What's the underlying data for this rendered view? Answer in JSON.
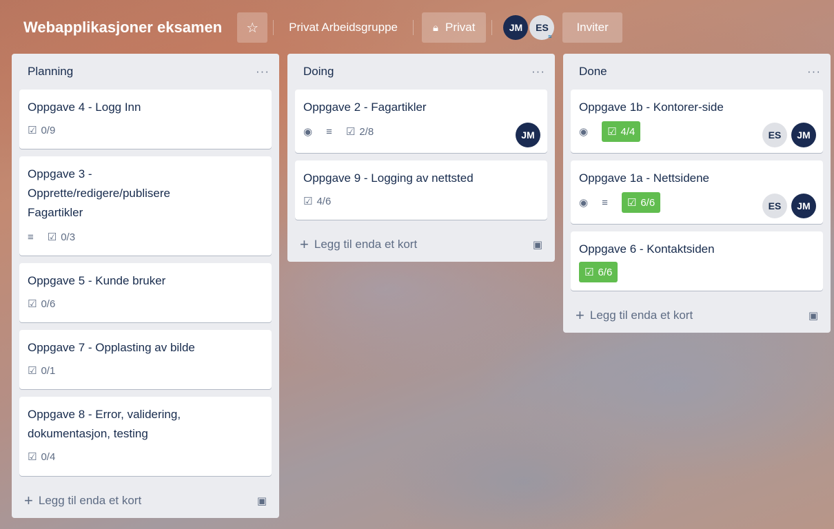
{
  "header": {
    "title": "Webapplikasjoner eksamen",
    "workspace": "Privat Arbeidsgruppe",
    "visibility": "Privat",
    "members": [
      {
        "initials": "JM"
      },
      {
        "initials": "ES"
      }
    ],
    "invite": "Inviter"
  },
  "add_card_label": "Legg til enda et kort",
  "lists": [
    {
      "title": "Planning",
      "cards": [
        {
          "title": "Oppgave 4 - Logg Inn",
          "checklist": "0/9"
        },
        {
          "title": "Oppgave 3 - Opprette/redigere/publisere Fagartikler",
          "checklist": "0/3"
        },
        {
          "title": "Oppgave 5 - Kunde bruker",
          "checklist": "0/6"
        },
        {
          "title": "Oppgave 7 - Opplasting av bilde",
          "checklist": "0/1"
        },
        {
          "title": "Oppgave 8 - Error, validering, dokumentasjon, testing",
          "checklist": "0/4"
        }
      ]
    },
    {
      "title": "Doing",
      "cards": [
        {
          "title": "Oppgave 2 - Fagartikler",
          "checklist": "2/8",
          "member": "JM"
        },
        {
          "title": "Oppgave 9 - Logging av nettsted",
          "checklist": "4/6"
        }
      ]
    },
    {
      "title": "Done",
      "cards": [
        {
          "title": "Oppgave 1b - Kontorer-side",
          "checklist": "4/4",
          "members": [
            "ES",
            "JM"
          ]
        },
        {
          "title": "Oppgave 1a - Nettsidene",
          "checklist": "6/6",
          "members": [
            "ES",
            "JM"
          ]
        },
        {
          "title": "Oppgave 6 - Kontaktsiden",
          "checklist": "6/6"
        }
      ]
    }
  ],
  "icons": {
    "star": "star-icon",
    "lock": "lock-icon",
    "menu": "more-icon",
    "watch": "eye-icon",
    "description": "description-icon",
    "checklist": "checklist-icon",
    "template": "card-template-icon"
  },
  "colors": {
    "list_bg": "#ebecf0",
    "complete_badge": "#61bd4f",
    "avatar_dark": "#1a2b52"
  }
}
